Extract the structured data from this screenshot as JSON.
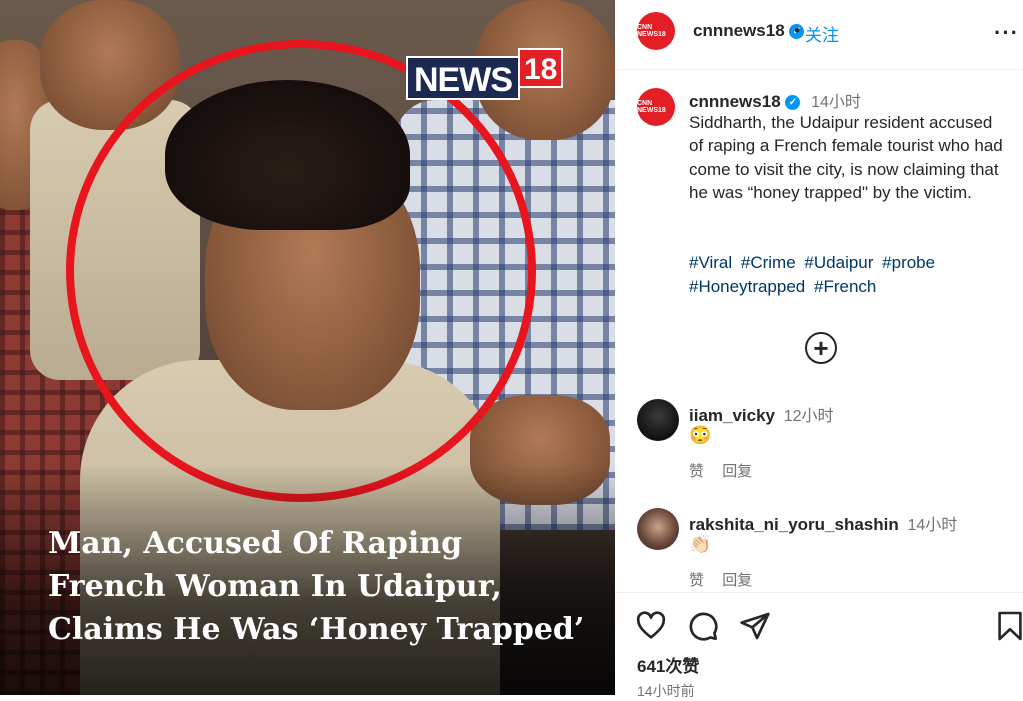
{
  "media": {
    "logo_word": "NEWS",
    "logo_number": "18",
    "caption_lines": [
      "Man, Accused Of Raping",
      "French Woman In Udaipur,",
      "Claims He Was ‘Honey Trapped’"
    ]
  },
  "header": {
    "username": "cnnnews18",
    "dot": "•",
    "follow_label": "关注",
    "more": "···",
    "avatar_text": "CNN NEWS18"
  },
  "post": {
    "username": "cnnnews18",
    "time": "14小时",
    "caption": "Siddharth, the Udaipur resident accused of raping a French female tourist who had come to visit the city, is now claiming that he was “honey trapped\" by the victim.",
    "hashtags": [
      "#Viral",
      "#Crime",
      "#Udaipur",
      "#probe",
      "#Honeytrapped",
      "#French"
    ],
    "more_comments_symbol": "+"
  },
  "comments": [
    {
      "username": "iiam_vicky",
      "time": "12小时",
      "emoji": "😳",
      "like_label": "赞",
      "reply_label": "回复"
    },
    {
      "username": "rakshita_ni_yoru_shashin",
      "time": "14小时",
      "emoji": "👏🏻",
      "like_label": "赞",
      "reply_label": "回复"
    }
  ],
  "actions": {
    "likes": "641次赞",
    "timestamp": "14小时前"
  },
  "colors": {
    "accent": "#0095f6",
    "brand_red": "#e31e24",
    "hashtag": "#00376b"
  }
}
